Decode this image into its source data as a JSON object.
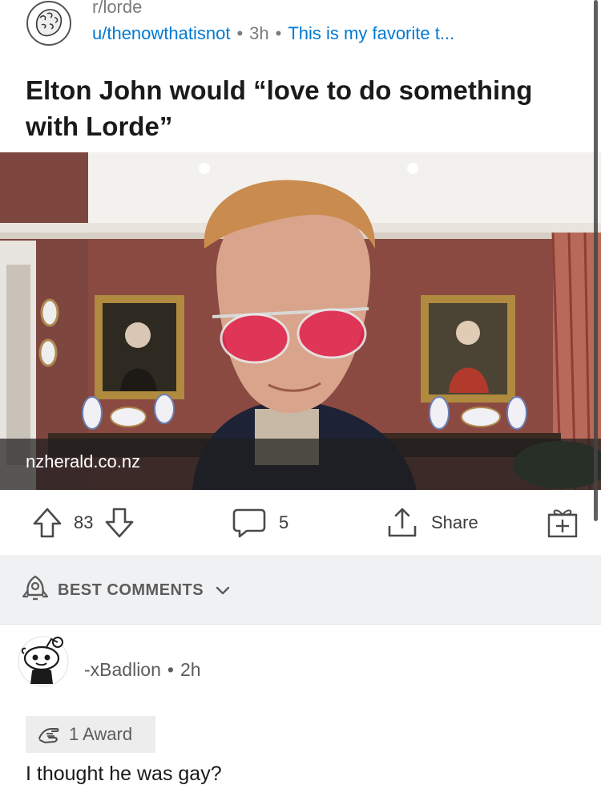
{
  "post": {
    "subreddit": "r/lorde",
    "author": "u/thenowthatisnot",
    "age": "3h",
    "flair": "This is my favorite t...",
    "title": "Elton John would “love to do something with Lorde”",
    "link_domain": "nzherald.co.nz",
    "icons": {
      "subreddit_avatar": "lion-seal-icon"
    }
  },
  "actions": {
    "score": "83",
    "comment_count": "5",
    "share_label": "Share",
    "icons": {
      "upvote": "arrow-up-icon",
      "downvote": "arrow-down-icon",
      "comment": "comment-bubble-icon",
      "share": "share-icon",
      "award": "gift-icon"
    }
  },
  "comments": {
    "sort_label": "BEST COMMENTS",
    "icons": {
      "sort": "rocket-icon",
      "dropdown": "chevron-down-icon"
    },
    "items": [
      {
        "author": "-xBadlion",
        "age": "2h",
        "award": "1 Award",
        "body": "I thought he was gay?"
      }
    ]
  },
  "colors": {
    "link_blue": "#0079d3",
    "meta_gray": "#7c7c7c",
    "bar_bg": "#f0f1f3"
  }
}
